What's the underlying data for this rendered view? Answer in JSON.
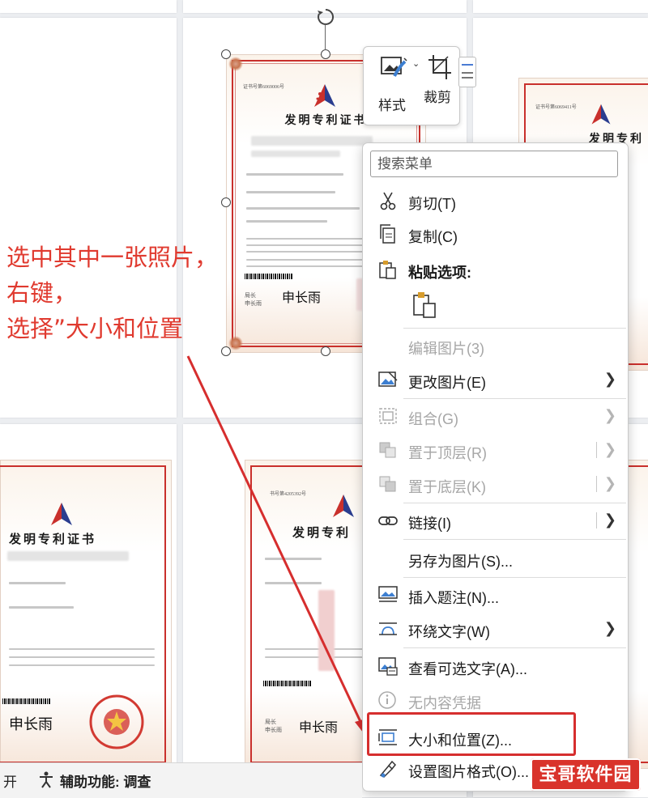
{
  "annotation": {
    "line1": "选中其中一张照片，",
    "line2": "右键，",
    "line3": "选择”大小和位置"
  },
  "certificate": {
    "title": "发明专利证书",
    "title_partial": "发明专利",
    "director_label": "局长",
    "director_name": "申长雨",
    "signature": "申长雨",
    "number_text_1": "证书号第6069006号",
    "number_text_2": "证书号第6069411号",
    "number_text_3": "书号第4205392号"
  },
  "mini_toolbar": {
    "style_label": "样式",
    "crop_label": "裁剪"
  },
  "context_menu": {
    "search_placeholder": "搜索菜单",
    "items": [
      {
        "label": "剪切(T)",
        "icon": "scissors-icon",
        "enabled": true
      },
      {
        "label": "复制(C)",
        "icon": "copy-icon",
        "enabled": true
      },
      {
        "label": "粘贴选项:",
        "icon": "paste-icon",
        "enabled": true,
        "bold": true
      },
      {
        "label": "编辑图片(3)",
        "icon": "",
        "enabled": false
      },
      {
        "label": "更改图片(E)",
        "icon": "change-picture-icon",
        "enabled": true,
        "submenu": true
      },
      {
        "label": "组合(G)",
        "icon": "group-icon",
        "enabled": false,
        "submenu": true
      },
      {
        "label": "置于顶层(R)",
        "icon": "bring-front-icon",
        "enabled": false,
        "submenu": true
      },
      {
        "label": "置于底层(K)",
        "icon": "send-back-icon",
        "enabled": false,
        "submenu": true
      },
      {
        "label": "链接(I)",
        "icon": "link-icon",
        "enabled": true,
        "submenu": true
      },
      {
        "label": "另存为图片(S)...",
        "icon": "",
        "enabled": true
      },
      {
        "label": "插入题注(N)...",
        "icon": "insert-caption-icon",
        "enabled": true
      },
      {
        "label": "环绕文字(W)",
        "icon": "wrap-text-icon",
        "enabled": true,
        "submenu": true
      },
      {
        "label": "查看可选文字(A)...",
        "icon": "alt-text-icon",
        "enabled": true
      },
      {
        "label": "无内容凭据",
        "icon": "info-icon",
        "enabled": false
      },
      {
        "label": "大小和位置(Z)...",
        "icon": "size-position-icon",
        "enabled": true,
        "highlighted": true
      },
      {
        "label": "设置图片格式(O)...",
        "icon": "format-picture-icon",
        "enabled": true
      }
    ]
  },
  "status_bar": {
    "left_text": "开",
    "accessibility_text": "辅助功能: 调查"
  },
  "watermark": "宝哥软件园",
  "colors": {
    "annotation_red": "#e03a2f",
    "highlight_red": "#d62e2e",
    "cert_border": "#c9302c"
  }
}
